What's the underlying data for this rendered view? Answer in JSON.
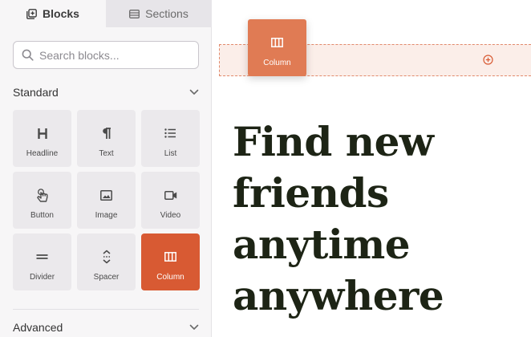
{
  "sidebar": {
    "tabs": [
      {
        "label": "Blocks",
        "icon": "add-square-icon",
        "active": true
      },
      {
        "label": "Sections",
        "icon": "sections-icon",
        "active": false
      }
    ],
    "search": {
      "placeholder": "Search blocks...",
      "value": ""
    },
    "groups": {
      "standard": {
        "label": "Standard",
        "expanded": true
      },
      "advanced": {
        "label": "Advanced",
        "expanded": false
      }
    },
    "blocks": [
      {
        "label": "Headline",
        "icon": "heading-icon"
      },
      {
        "label": "Text",
        "icon": "paragraph-icon"
      },
      {
        "label": "List",
        "icon": "list-icon"
      },
      {
        "label": "Button",
        "icon": "pointer-hand-icon"
      },
      {
        "label": "Image",
        "icon": "image-icon"
      },
      {
        "label": "Video",
        "icon": "video-camera-icon"
      },
      {
        "label": "Divider",
        "icon": "divider-icon"
      },
      {
        "label": "Spacer",
        "icon": "spacer-icon"
      },
      {
        "label": "Column",
        "icon": "column-icon",
        "active": true
      }
    ]
  },
  "canvas": {
    "drag_ghost": {
      "label": "Column",
      "icon": "column-icon"
    },
    "headline_lines": [
      "Find new",
      "friends",
      "anytime",
      "anywhere"
    ]
  },
  "colors": {
    "accent": "#d85a33",
    "drag_ghost": "#e07b54",
    "drop_zone_bg": "#fbeee9",
    "drop_zone_border": "#e18a6c",
    "headline": "#1d2415",
    "sidebar_bg": "#f7f6f7",
    "block_bg": "#ebe9ec"
  }
}
